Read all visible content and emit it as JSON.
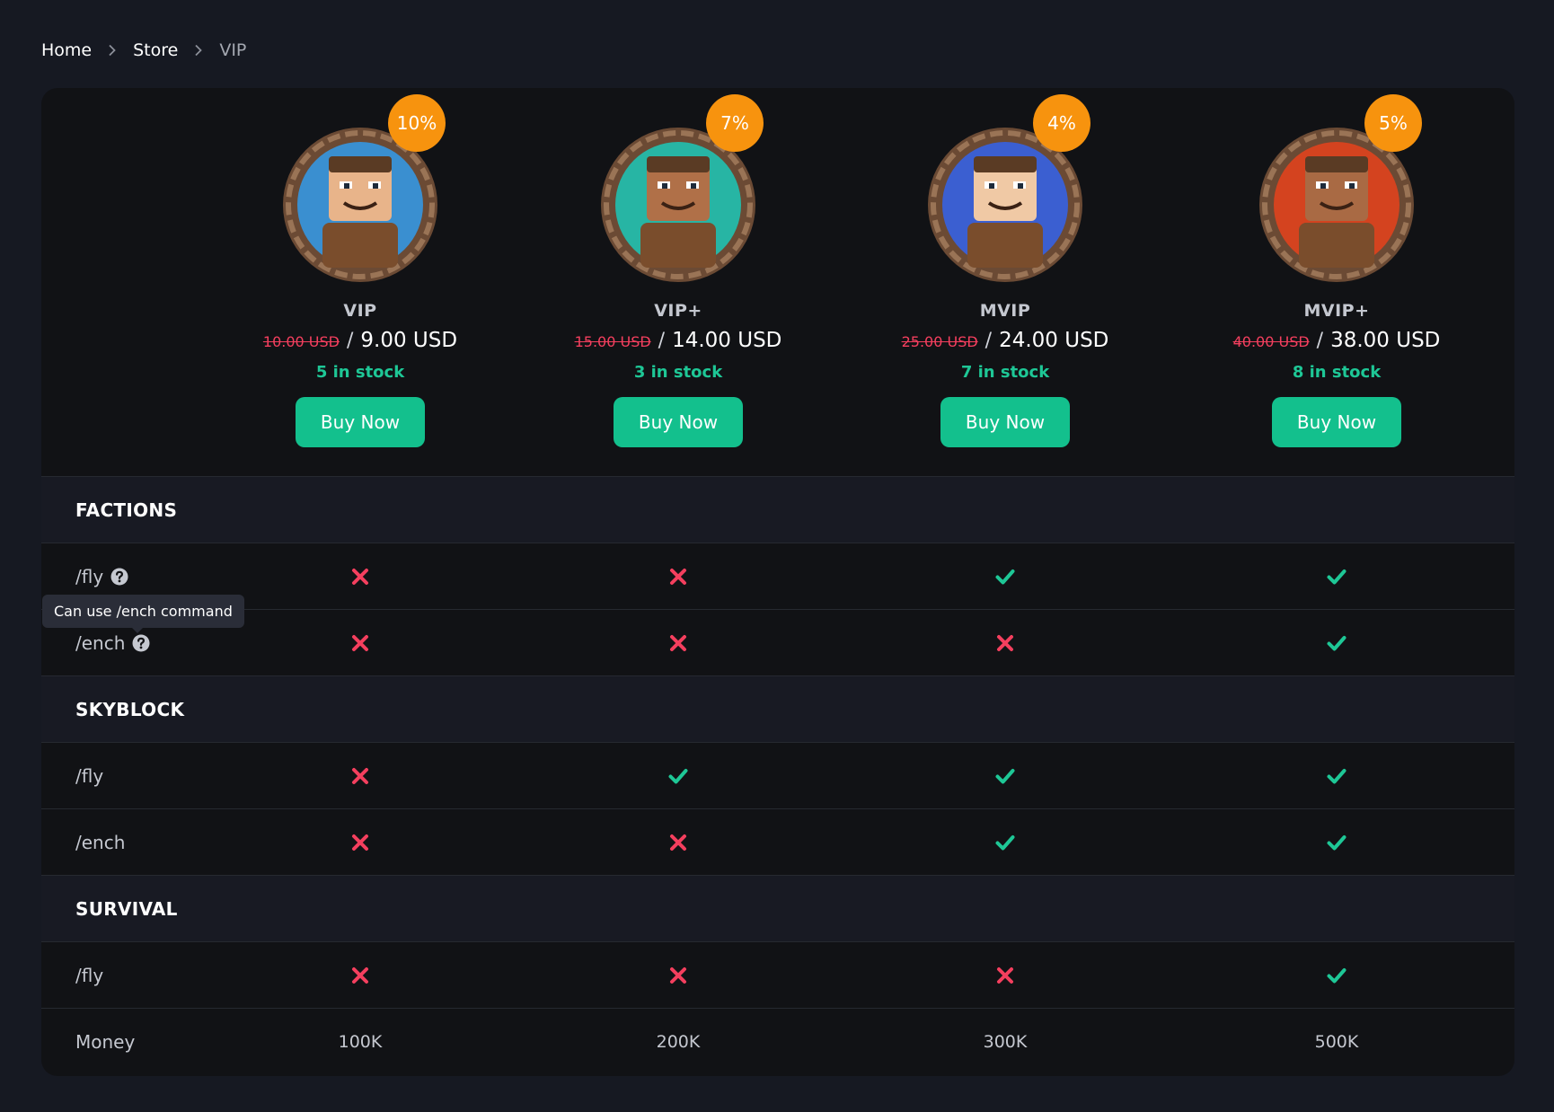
{
  "breadcrumb": {
    "home": "Home",
    "store": "Store",
    "current": "VIP"
  },
  "colors": {
    "accent": "#13c08d",
    "badge": "#f7930e",
    "cross": "#f43f5e",
    "check": "#1ec796"
  },
  "packages": [
    {
      "name": "VIP",
      "discount": "10%",
      "old_price": "10.00 USD",
      "separator": "/",
      "price": "9.00 USD",
      "stock": "5 in stock",
      "buy_label": "Buy Now",
      "ring": "#3a8fd0",
      "skin": "#e8b48a"
    },
    {
      "name": "VIP+",
      "discount": "7%",
      "old_price": "15.00 USD",
      "separator": "/",
      "price": "14.00 USD",
      "stock": "3 in stock",
      "buy_label": "Buy Now",
      "ring": "#27b5a4",
      "skin": "#b07048"
    },
    {
      "name": "MVIP",
      "discount": "4%",
      "old_price": "25.00 USD",
      "separator": "/",
      "price": "24.00 USD",
      "stock": "7 in stock",
      "buy_label": "Buy Now",
      "ring": "#3b5fd1",
      "skin": "#f0c9a5"
    },
    {
      "name": "MVIP+",
      "discount": "5%",
      "old_price": "40.00 USD",
      "separator": "/",
      "price": "38.00 USD",
      "stock": "8 in stock",
      "buy_label": "Buy Now",
      "ring": "#d4431f",
      "skin": "#a96a44"
    }
  ],
  "sections": [
    {
      "title": "FACTIONS",
      "rows": [
        {
          "label": "/fly",
          "help": true,
          "values": [
            "cross",
            "cross",
            "check",
            "check"
          ]
        },
        {
          "label": "/ench",
          "help": true,
          "values": [
            "cross",
            "cross",
            "cross",
            "check"
          ]
        }
      ]
    },
    {
      "title": "SKYBLOCK",
      "rows": [
        {
          "label": "/fly",
          "help": false,
          "values": [
            "cross",
            "check",
            "check",
            "check"
          ]
        },
        {
          "label": "/ench",
          "help": false,
          "values": [
            "cross",
            "cross",
            "check",
            "check"
          ]
        }
      ]
    },
    {
      "title": "SURVIVAL",
      "rows": [
        {
          "label": "/fly",
          "help": false,
          "values": [
            "cross",
            "cross",
            "cross",
            "check"
          ]
        },
        {
          "label": "Money",
          "help": false,
          "values": [
            "100K",
            "200K",
            "300K",
            "500K"
          ]
        }
      ]
    }
  ],
  "tooltip": {
    "text": "Can use /ench command"
  },
  "icons": {
    "separator": "chevron-right-icon",
    "help": "question-circle-icon",
    "yes": "check-icon",
    "no": "cross-icon"
  }
}
